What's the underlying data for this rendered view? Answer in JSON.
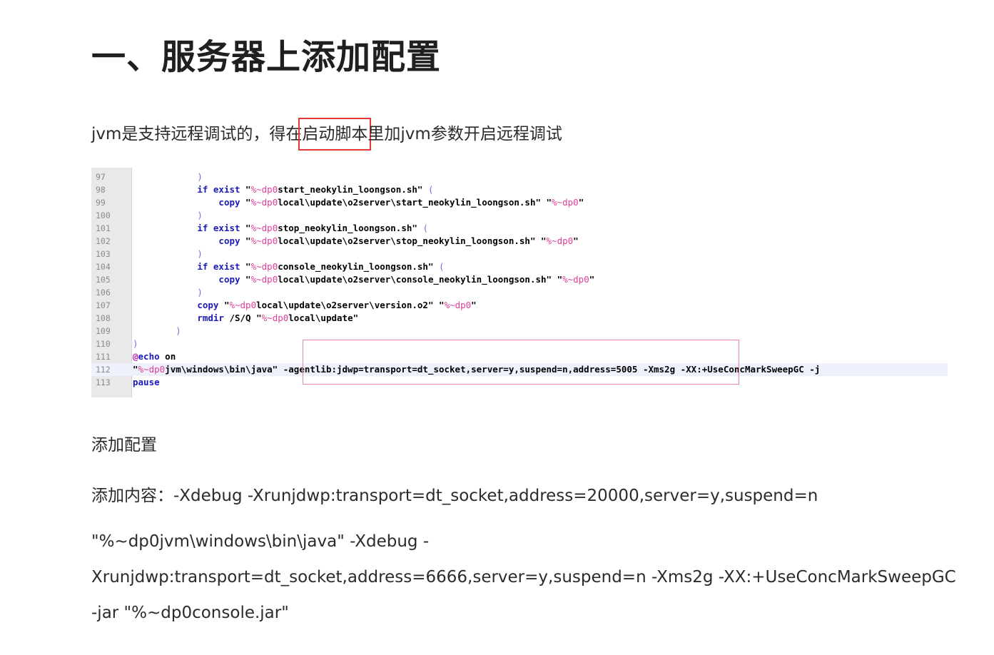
{
  "heading": "一、服务器上添加配置",
  "intro": {
    "before": "jvm是支持远程调试的，得在",
    "highlight": "启动脚本",
    "after": "里加jvm参数开启远程调试"
  },
  "code_screenshot": {
    "lines": [
      {
        "num": "97",
        "text": "            )"
      },
      {
        "num": "98",
        "text": "            if exist \"%~dp0start_neokylin_loongson.sh\" ("
      },
      {
        "num": "99",
        "text": "                copy \"%~dp0local\\update\\o2server\\start_neokylin_loongson.sh\" \"%~dp0\""
      },
      {
        "num": "100",
        "text": "            )"
      },
      {
        "num": "101",
        "text": "            if exist \"%~dp0stop_neokylin_loongson.sh\" ("
      },
      {
        "num": "102",
        "text": "                copy \"%~dp0local\\update\\o2server\\stop_neokylin_loongson.sh\" \"%~dp0\""
      },
      {
        "num": "103",
        "text": "            )"
      },
      {
        "num": "104",
        "text": "            if exist \"%~dp0console_neokylin_loongson.sh\" ("
      },
      {
        "num": "105",
        "text": "                copy \"%~dp0local\\update\\o2server\\console_neokylin_loongson.sh\" \"%~dp0\""
      },
      {
        "num": "106",
        "text": "            )"
      },
      {
        "num": "107",
        "text": "            copy \"%~dp0local\\update\\o2server\\version.o2\" \"%~dp0\""
      },
      {
        "num": "108",
        "text": "            rmdir /S/Q \"%~dp0local\\update\""
      },
      {
        "num": "109",
        "text": "        )"
      },
      {
        "num": "110",
        "text": ")"
      },
      {
        "num": "111",
        "text": "@echo on"
      },
      {
        "num": "112",
        "text": "\"%~dp0jvm\\windows\\bin\\java\" -agentlib:jdwp=transport=dt_socket,server=y,suspend=n,address=5005 -Xms2g -XX:+UseConcMarkSweepGC -j"
      },
      {
        "num": "113",
        "text": "pause"
      }
    ]
  },
  "paragraphs": {
    "add_config": "添加配置",
    "add_content": "添加内容：-Xdebug -Xrunjdwp:transport=dt_socket,address=20000,server=y,suspend=n",
    "cmd_line1": "\"%~dp0jvm\\windows\\bin\\java\" -Xdebug -",
    "cmd_line2": "Xrunjdwp:transport=dt_socket,address=6666,server=y,suspend=n -Xms2g -XX:+UseConcMarkSweepGC",
    "cmd_line3": "-jar \"%~dp0console.jar\""
  },
  "colors": {
    "highlight_border": "#e53935",
    "code_mark_border": "#f0879a",
    "keyword": "#1a1ab8",
    "variable": "#e0409a"
  }
}
